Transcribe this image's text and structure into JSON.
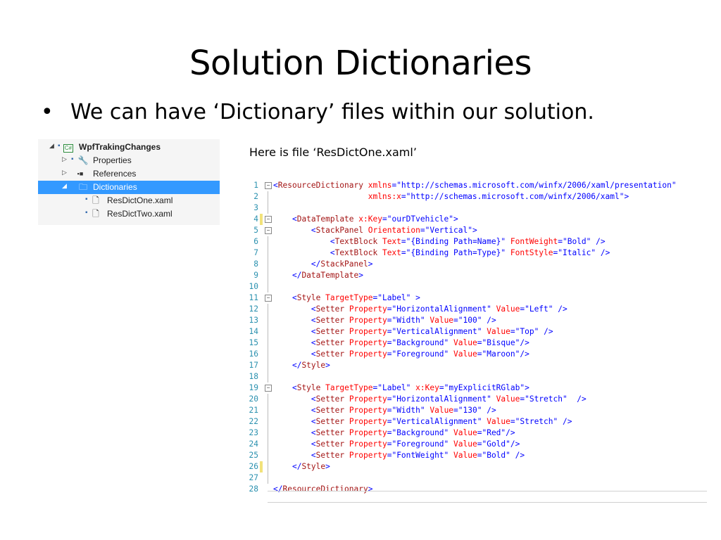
{
  "slide": {
    "title": "Solution Dictionaries",
    "bullet_symbol": "•",
    "bullet_text": "We can have ‘Dictionary’ files within our solution.",
    "file_caption": "Here is file ‘ResDictOne.xaml’"
  },
  "solution_explorer": {
    "project": "WpfTrakingChanges",
    "project_badge": "C#",
    "items": [
      {
        "label": "Properties",
        "icon": "wrench-icon"
      },
      {
        "label": "References",
        "icon": "references-icon"
      },
      {
        "label": "Dictionaries",
        "icon": "folder-icon",
        "selected": true
      },
      {
        "label": "ResDictOne.xaml",
        "icon": "xaml-file-icon"
      },
      {
        "label": "ResDictTwo.xaml",
        "icon": "xaml-file-icon"
      }
    ],
    "selection_color": "#3399ff"
  },
  "code_editor": {
    "language": "XAML",
    "line_numbers": [
      "1",
      "2",
      "3",
      "4",
      "5",
      "6",
      "7",
      "8",
      "9",
      "10",
      "11",
      "12",
      "13",
      "14",
      "15",
      "16",
      "17",
      "18",
      "19",
      "20",
      "21",
      "22",
      "23",
      "24",
      "25",
      "26",
      "27",
      "28"
    ],
    "lines": [
      "<ResourceDictionary xmlns=\"http://schemas.microsoft.com/winfx/2006/xaml/presentation\"",
      "                    xmlns:x=\"http://schemas.microsoft.com/winfx/2006/xaml\">",
      "",
      "    <DataTemplate x:Key=\"ourDTvehicle\">",
      "        <StackPanel Orientation=\"Vertical\">",
      "            <TextBlock Text=\"{Binding Path=Name}\" FontWeight=\"Bold\" />",
      "            <TextBlock Text=\"{Binding Path=Type}\" FontStyle=\"Italic\" />",
      "        </StackPanel>",
      "    </DataTemplate>",
      "",
      "    <Style TargetType=\"Label\" >",
      "        <Setter Property=\"HorizontalAlignment\" Value=\"Left\" />",
      "        <Setter Property=\"Width\" Value=\"100\" />",
      "        <Setter Property=\"VerticalAlignment\" Value=\"Top\" />",
      "        <Setter Property=\"Background\" Value=\"Bisque\"/>",
      "        <Setter Property=\"Foreground\" Value=\"Maroon\"/>",
      "    </Style>",
      "",
      "    <Style TargetType=\"Label\" x:Key=\"myExplicitRGlab\">",
      "        <Setter Property=\"HorizontalAlignment\" Value=\"Stretch\"  />",
      "        <Setter Property=\"Width\" Value=\"130\" />",
      "        <Setter Property=\"VerticalAlignment\" Value=\"Stretch\" />",
      "        <Setter Property=\"Background\" Value=\"Red\"/>",
      "        <Setter Property=\"Foreground\" Value=\"Gold\"/>",
      "        <Setter Property=\"FontWeight\" Value=\"Bold\" />",
      "    </Style>",
      "",
      "</ResourceDictionary>"
    ],
    "collapsible_lines": [
      1,
      4,
      5,
      11,
      19
    ],
    "changed_lines": [
      4,
      26
    ],
    "colors": {
      "tag": "#a31515",
      "attribute": "#ff0000",
      "value": "#0000ff",
      "punctuation": "#0000ff",
      "line_number": "#2b91af",
      "change_marker": "#f2e27a"
    }
  }
}
